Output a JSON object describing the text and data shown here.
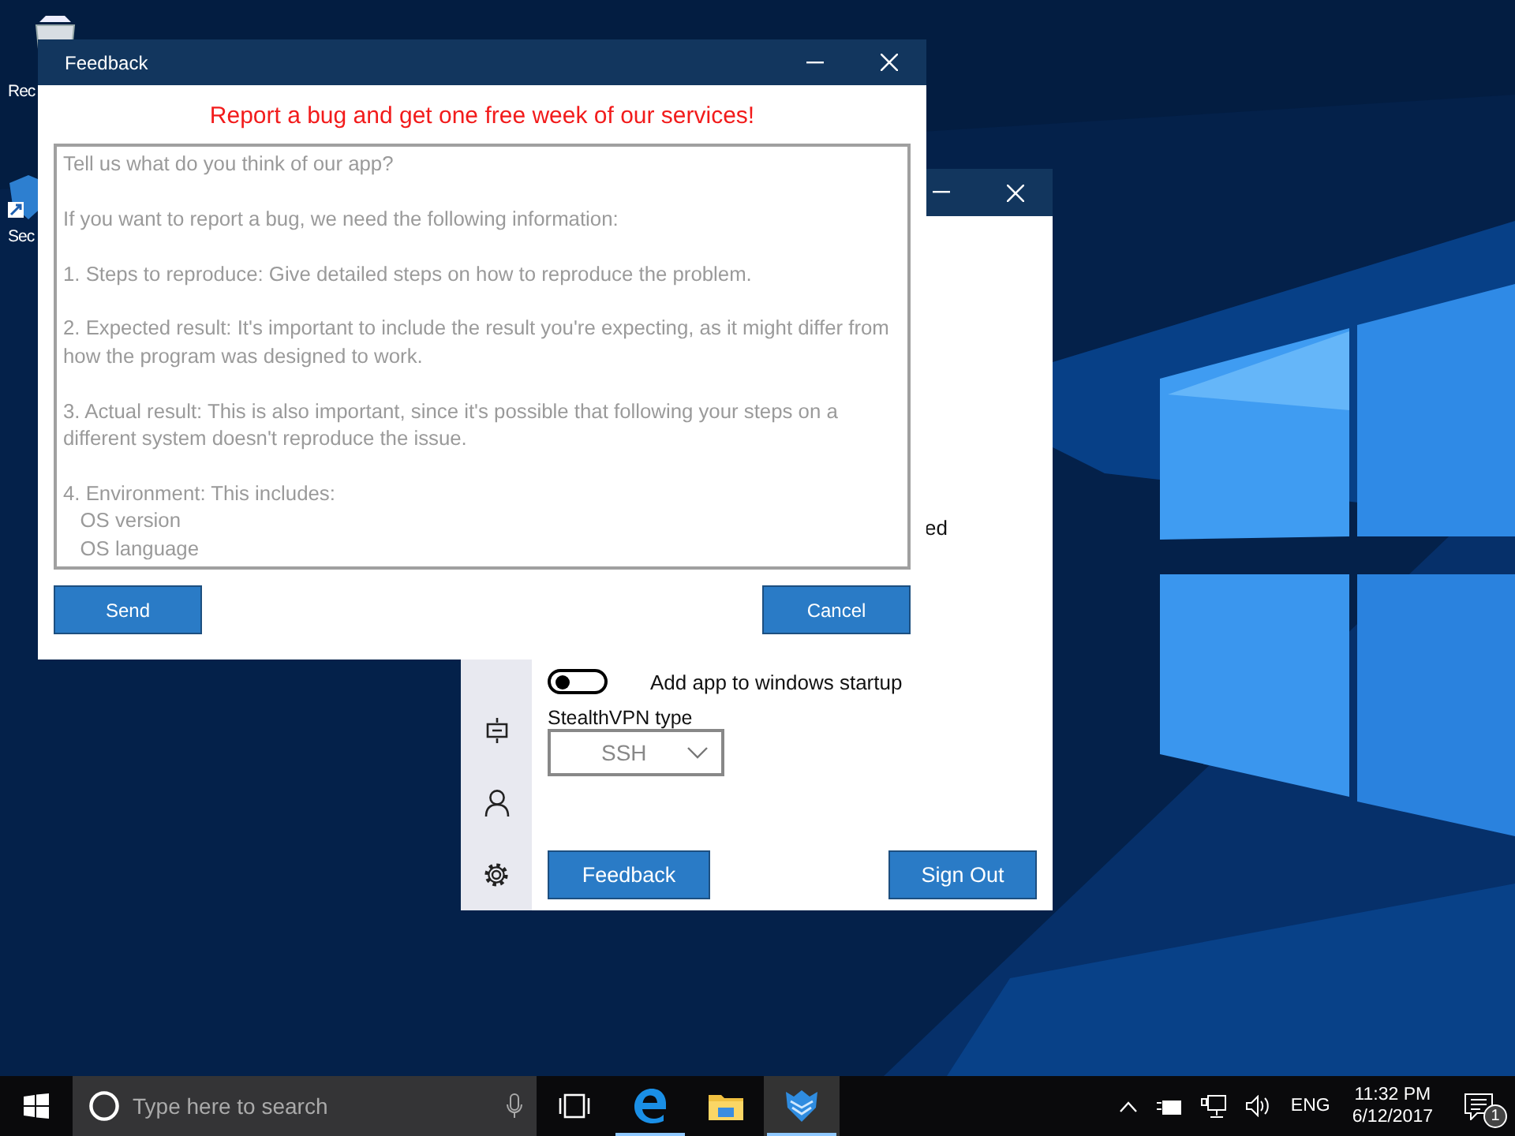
{
  "desktop_icons": [
    {
      "label": "Rec"
    },
    {
      "label": "Sec"
    }
  ],
  "main_window": {
    "partial_text": "ed",
    "startup_toggle": {
      "label": "Add app to windows startup",
      "on": false
    },
    "vpn_type": {
      "label": "StealthVPN type",
      "value": "SSH"
    },
    "buttons": [
      "Feedback",
      "Sign Out"
    ]
  },
  "feedback_window": {
    "title": "Feedback",
    "headline": "Report a bug and get one free week of our services!",
    "message_field": {
      "placeholder": "Tell us what do you think of our app?\n\nIf you want to report a bug, we need the following information:\n\n1. Steps to reproduce: Give detailed steps on how to reproduce the problem.\n\n2. Expected result: It's important to include the result you're expecting, as it might differ from how the program was designed to work.\n\n3. Actual result: This is also important, since it's possible that following your steps on a different system doesn't reproduce the issue.\n\n4. Environment: This includes:\n   OS version\n   OS language"
    },
    "buttons": [
      "Send",
      "Cancel"
    ]
  },
  "taskbar": {
    "search": {
      "placeholder": "Type here to search"
    },
    "apps": [
      {
        "kind": "task-view",
        "running": false,
        "selected": false
      },
      {
        "kind": "browser",
        "running": true,
        "selected": false
      },
      {
        "kind": "folder",
        "running": false,
        "selected": false
      },
      {
        "kind": "shield",
        "running": true,
        "selected": true
      }
    ],
    "language": "ENG",
    "time": "11:32 PM",
    "date": "6/12/2017",
    "notification_count": "1"
  }
}
